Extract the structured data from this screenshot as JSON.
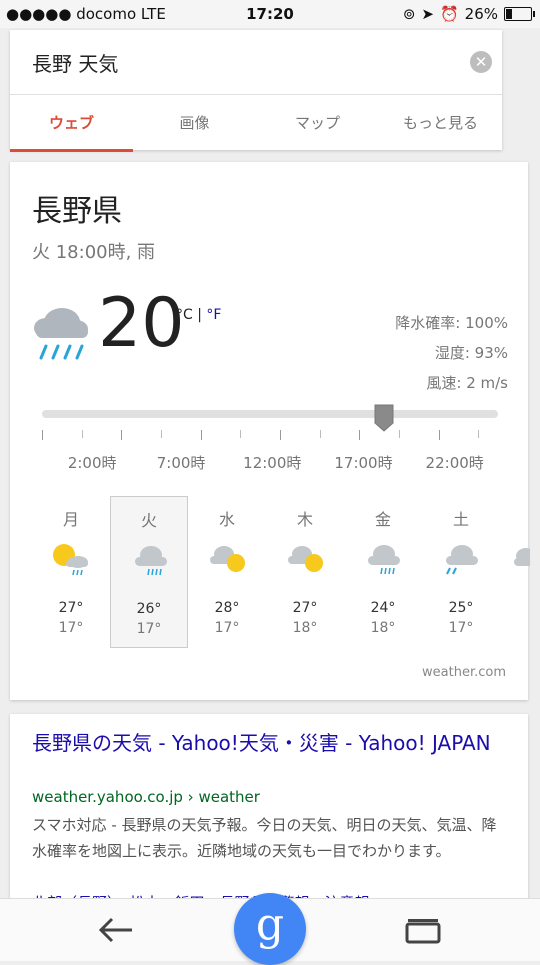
{
  "status_bar": {
    "carrier": "●●●●● docomo  LTE",
    "time": "17:20",
    "battery": "26%",
    "battery_level": 0.26
  },
  "search": {
    "query": "長野 天気",
    "clear_icon": "close-circle-icon",
    "tabs": [
      {
        "label": "ウェブ",
        "active": true
      },
      {
        "label": "画像",
        "active": false
      },
      {
        "label": "マップ",
        "active": false
      },
      {
        "label": "もっと見る",
        "active": false
      }
    ]
  },
  "weather": {
    "location": "長野県",
    "subtitle": "火 18:00時, 雨",
    "temperature": "20",
    "unit_c": "°C",
    "unit_sep": " | ",
    "unit_f": "°F",
    "precip": "降水確率: 100%",
    "humidity": "湿度: 93%",
    "wind": "風速: 2 m/s",
    "slider_position": 0.75,
    "time_labels": [
      "2:00時",
      "7:00時",
      "12:00時",
      "17:00時",
      "22:00時"
    ],
    "days": [
      {
        "name": "月",
        "icon": "sun-cloud-rain-icon",
        "high": "27°",
        "low": "17°"
      },
      {
        "name": "火",
        "icon": "cloud-rain-icon",
        "high": "26°",
        "low": "17°",
        "selected": true
      },
      {
        "name": "水",
        "icon": "partly-cloudy-icon",
        "high": "28°",
        "low": "17°"
      },
      {
        "name": "木",
        "icon": "partly-cloudy-icon",
        "high": "27°",
        "low": "18°"
      },
      {
        "name": "金",
        "icon": "cloud-rain-icon",
        "high": "24°",
        "low": "18°"
      },
      {
        "name": "土",
        "icon": "cloud-rain-icon",
        "high": "25°",
        "low": "17°"
      }
    ],
    "source": "weather.com"
  },
  "result": {
    "title": "長野県の天気 - Yahoo!天気・災害 - Yahoo! JAPAN",
    "url": "weather.yahoo.co.jp › weather",
    "snippet_prefix": "スマホ対応 - ",
    "snippet": "長野県の天気予報。今日の天気、明日の天気、気温、降水確率を地図上に表示。近隣地域の天気も一目でわかります。",
    "more": "北部（長野）・松本・飯田・長野県の警報・注意報"
  },
  "bottom_bar": {
    "back_icon": "back-arrow-icon",
    "google_label": "g",
    "tabs_icon": "tabs-icon"
  },
  "colors": {
    "accent": "#dd4b39",
    "link": "#1a0dab",
    "url": "#006621",
    "google_blue": "#4285f4"
  }
}
